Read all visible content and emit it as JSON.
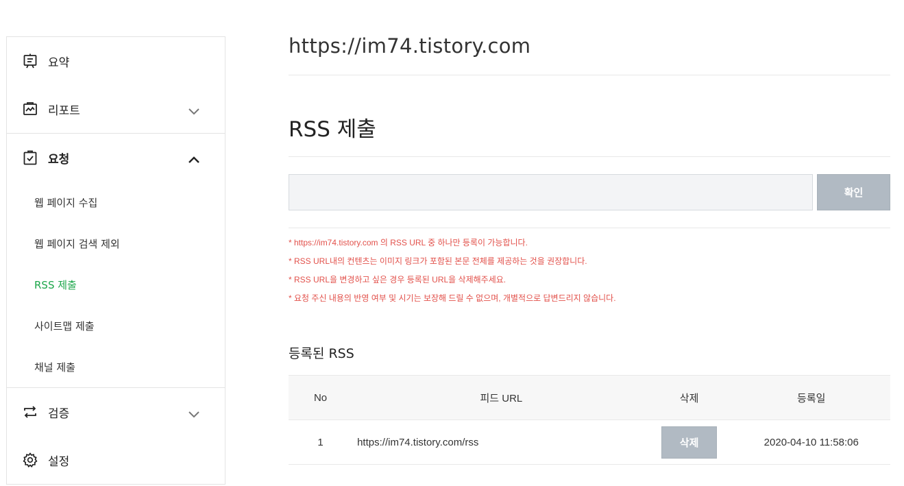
{
  "sidebar": {
    "items": [
      {
        "label": "요약",
        "icon": "summary-icon"
      },
      {
        "label": "리포트",
        "icon": "report-icon"
      },
      {
        "label": "요청",
        "icon": "request-icon"
      },
      {
        "label": "검증",
        "icon": "verify-icon"
      },
      {
        "label": "설정",
        "icon": "settings-icon"
      }
    ],
    "sub_items": [
      {
        "label": "웹 페이지 수집"
      },
      {
        "label": "웹 페이지 검색 제외"
      },
      {
        "label": "RSS 제출"
      },
      {
        "label": "사이트맵 제출"
      },
      {
        "label": "채널 제출"
      }
    ]
  },
  "main": {
    "site_url": "https://im74.tistory.com",
    "section_title": "RSS 제출",
    "input": {
      "value": "",
      "placeholder": ""
    },
    "confirm_label": "확인",
    "notes": [
      "* https://im74.tistory.com 의 RSS URL 중 하나만 등록이 가능합니다.",
      "* RSS URL내의 컨텐츠는 이미지 링크가 포함된 본문 전체를 제공하는 것을 권장합니다.",
      "* RSS URL을 변경하고 싶은 경우 등록된 URL을 삭제해주세요.",
      "* 요청 주신 내용의 반영 여부 및 시기는 보장해 드릴 수 없으며, 개별적으로 답변드리지 않습니다."
    ],
    "registered_heading": "등록된 RSS",
    "table": {
      "headers": {
        "no": "No",
        "url": "피드 URL",
        "delete": "삭제",
        "date": "등록일"
      },
      "rows": [
        {
          "no": "1",
          "url": "https://im74.tistory.com/rss",
          "delete_label": "삭제",
          "date": "2020-04-10 11:58:06"
        }
      ]
    }
  },
  "colors": {
    "accent": "#1ca64a",
    "note": "#e2504a",
    "button": "#b1bac3"
  }
}
